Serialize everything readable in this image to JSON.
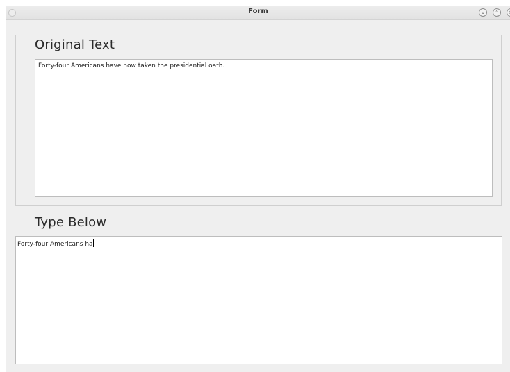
{
  "window": {
    "title": "Form",
    "minimize_glyph": "⌄",
    "maximize_glyph": "⌃",
    "close_glyph": "×"
  },
  "original": {
    "label": "Original Text",
    "text": "Forty-four Americans have now taken the presidential oath."
  },
  "typing": {
    "label": "Type Below",
    "value": "Forty-four Americans ha"
  },
  "icons": {
    "window_menu": "circle-icon",
    "minimize": "chevron-down-icon",
    "maximize": "chevron-up-icon",
    "close": "close-icon"
  }
}
